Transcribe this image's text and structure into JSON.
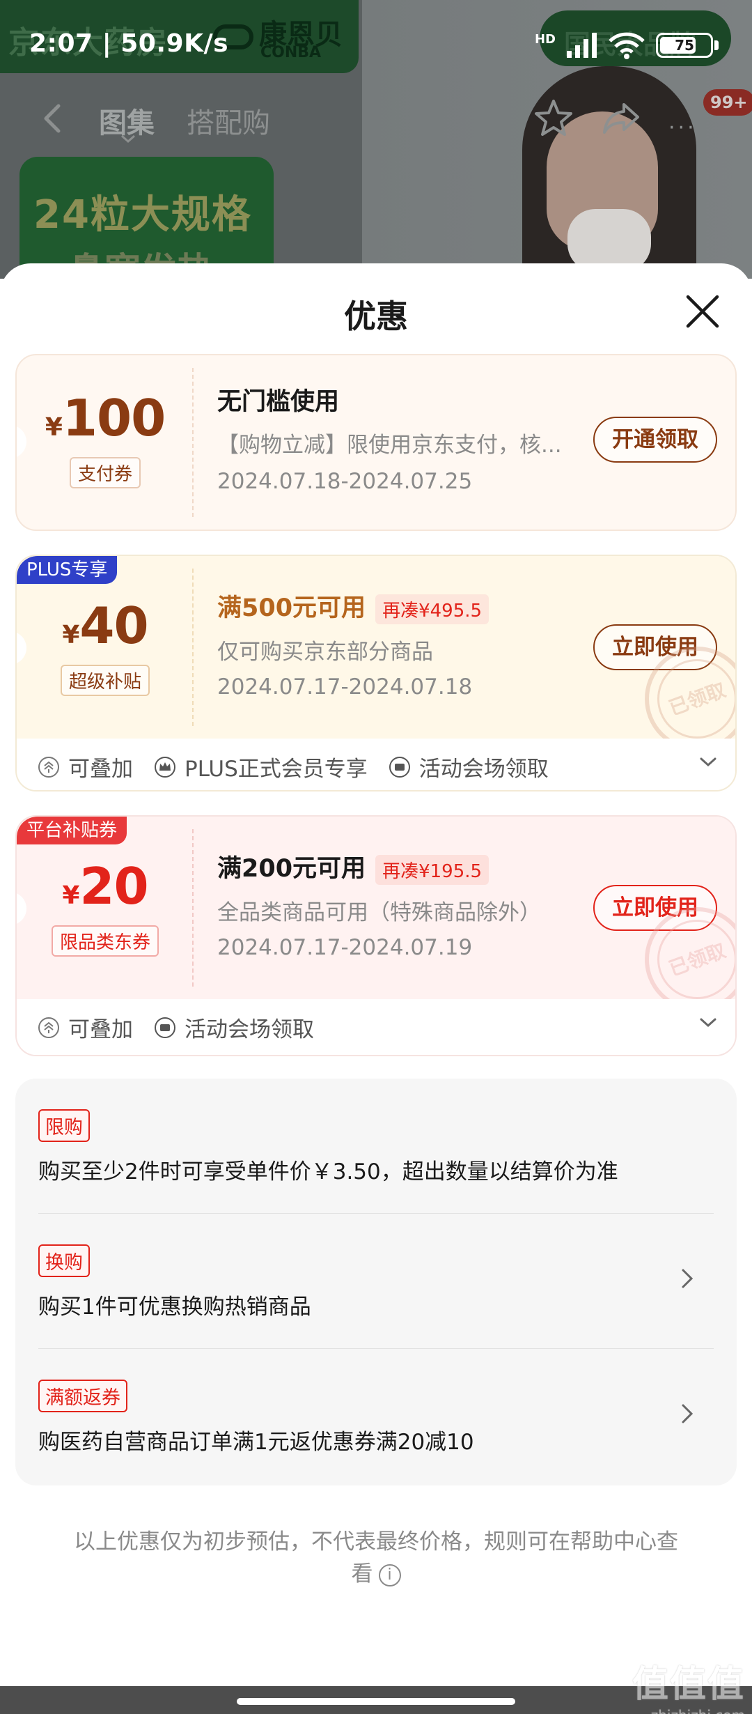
{
  "status_bar": {
    "time": "2:07 | 50.9K/s",
    "network_label": "HD",
    "battery": "75",
    "battery_level": 0.75
  },
  "background": {
    "brand_text": "京东大药房",
    "logo_cn": "康恩贝",
    "logo_en": "CONBA",
    "right_pill_text": "国民大品牌",
    "banner_line1": "24粒大规格",
    "banner_line2": "鼻塞发热"
  },
  "nav": {
    "tab_gallery": "图集",
    "tab_bundle": "搭配购",
    "badge": "99+",
    "more": "···"
  },
  "sheet": {
    "title": "优惠"
  },
  "coupons": [
    {
      "currency": "¥",
      "amount": "100",
      "type_label": "支付券",
      "title": "无门槛使用",
      "desc": "【购物立减】限使用京东支付，核...",
      "date": "2024.07.18-2024.07.25",
      "button": "开通领取"
    },
    {
      "corner_tag": "PLUS专享",
      "currency": "¥",
      "amount": "40",
      "type_label": "超级补贴",
      "title": "满500元可用",
      "need_tag": "再凑¥495.5",
      "desc": "仅可购买京东部分商品",
      "date": "2024.07.17-2024.07.18",
      "button": "立即使用",
      "stamp": "已领取",
      "foot": [
        "可叠加",
        "PLUS正式会员专享",
        "活动会场领取"
      ]
    },
    {
      "corner_tag": "平台补贴券",
      "currency": "¥",
      "amount": "20",
      "type_label": "限品类东券",
      "title": "满200元可用",
      "need_tag": "再凑¥195.5",
      "desc": "全品类商品可用（特殊商品除外）",
      "date": "2024.07.17-2024.07.19",
      "button": "立即使用",
      "stamp": "已领取",
      "foot": [
        "可叠加",
        "活动会场领取"
      ]
    }
  ],
  "promos": [
    {
      "tag": "限购",
      "text": "购买至少2件时可享受单件价￥3.50，超出数量以结算价为准"
    },
    {
      "tag": "换购",
      "text": "购买1件可优惠换购热销商品"
    },
    {
      "tag": "满额返券",
      "text": "购医药自营商品订单满1元返优惠券满20减10"
    }
  ],
  "disclaimer": "以上优惠仅为初步预估，不代表最终价格，规则可在帮助中心查看",
  "watermark": {
    "big": "值值值",
    "small": "zhizhizhi.com"
  },
  "colors": {
    "plus_tag": "#2f40c8",
    "platform_tag": "#e8393b",
    "price_brown": "#8a3b12",
    "price_red": "#e2231a",
    "coupon1_bg": "#fff8f2",
    "coupon2_bg": "#fff8e8",
    "coupon3_bg": "#fff2f1"
  }
}
